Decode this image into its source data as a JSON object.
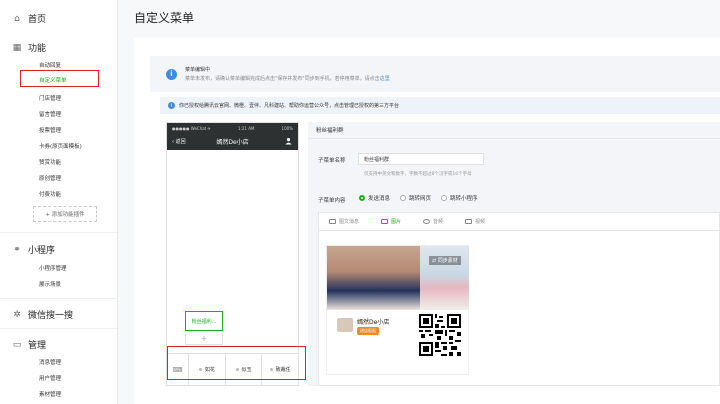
{
  "sidebar": {
    "home": "首页",
    "functions": "功能",
    "function_items": [
      "自动回复",
      "自定义菜单",
      "门店管理",
      "留言管理",
      "投票管理",
      "卡券(原页面模板)",
      "赞赏功能",
      "原创管理",
      "付费功能"
    ],
    "add_plugin": "+ 添加功能插件",
    "mini_program": "小程序",
    "mini_items": [
      "小程序管理",
      "展示场景"
    ],
    "wechat_search": "微信搜一搜",
    "manage": "管理",
    "manage_items": [
      "消息管理",
      "用户管理",
      "素材管理"
    ]
  },
  "page_title": "自定义菜单",
  "banner1": {
    "title": "菜单编辑中",
    "desc": "菜单未发布，请确认菜单编辑完成后点击\"保存并发布\"同步到手机。若停用菜单，请点击",
    "link": "这里"
  },
  "banner2": {
    "text": "你已授权给腾讯云官网、微橙、壹伴、凡科建站、帮助你运营公众号，点击管理已授权的第三方平台"
  },
  "phone": {
    "carrier": "●●●●● WeChat ✈",
    "time": "1:21 AM",
    "battery": "100%",
    "back": "返回",
    "title": "嫣然De小店",
    "bubble": "粉丝福利...",
    "plus": "+",
    "menu_items": [
      "如花",
      "似玉",
      "致裁任"
    ]
  },
  "editor": {
    "header": "粉丝福利群",
    "name_label": "子菜单名称",
    "name_value": "粉丝福利群",
    "name_hint": "仅支持中英文和数字，字数不超过8个汉字或16个字母",
    "content_label": "子菜单内容",
    "radios": [
      "发送消息",
      "跳转网页",
      "跳转小程序"
    ],
    "tabs": [
      "图文消息",
      "图片",
      "音频",
      "视频"
    ],
    "poster_tag": "同步素材",
    "shop_name": "嫣然De小店",
    "shop_button": "进店逛逛"
  },
  "colors": {
    "accent": "#1aad19",
    "highlight": "#d9232d",
    "info": "#3e8ed9"
  }
}
